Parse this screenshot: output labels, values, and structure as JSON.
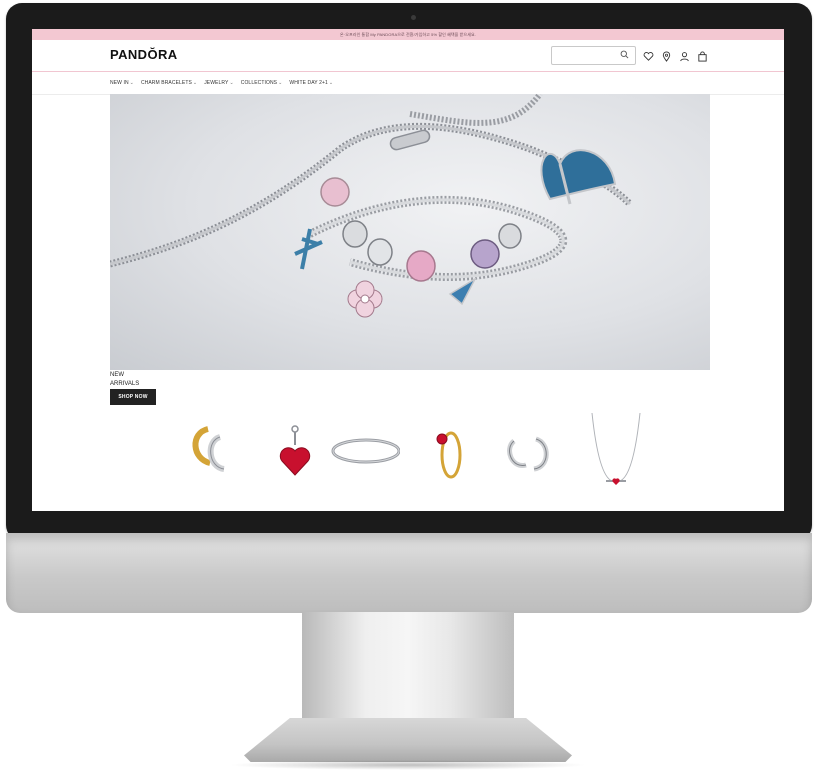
{
  "promo": {
    "text": "온·오프라인 통합 My PANDORA으로 전환/가입하고 5% 할인 혜택을 받으세요."
  },
  "header": {
    "logo": "PANDŎRA",
    "search_placeholder": ""
  },
  "nav": {
    "items": [
      {
        "label": "NEW IN"
      },
      {
        "label": "CHARM BRACELETS"
      },
      {
        "label": "JEWELRY"
      },
      {
        "label": "COLLECTIONS"
      },
      {
        "label": "WHITE DAY 2+1"
      }
    ]
  },
  "hero": {
    "line1": "NEW",
    "line2": "ARRIVALS",
    "button": "SHOP NOW"
  },
  "products": [
    {
      "name": "gold-silver-hoop-earrings"
    },
    {
      "name": "red-heart-charm"
    },
    {
      "name": "silver-bracelet"
    },
    {
      "name": "red-stone-gold-ring"
    },
    {
      "name": "silver-hoop-earrings"
    },
    {
      "name": "heart-pendant-necklace"
    }
  ],
  "colors": {
    "promo_bg": "#f3c8d2",
    "button_bg": "#222222",
    "accent": "#c8102e"
  }
}
